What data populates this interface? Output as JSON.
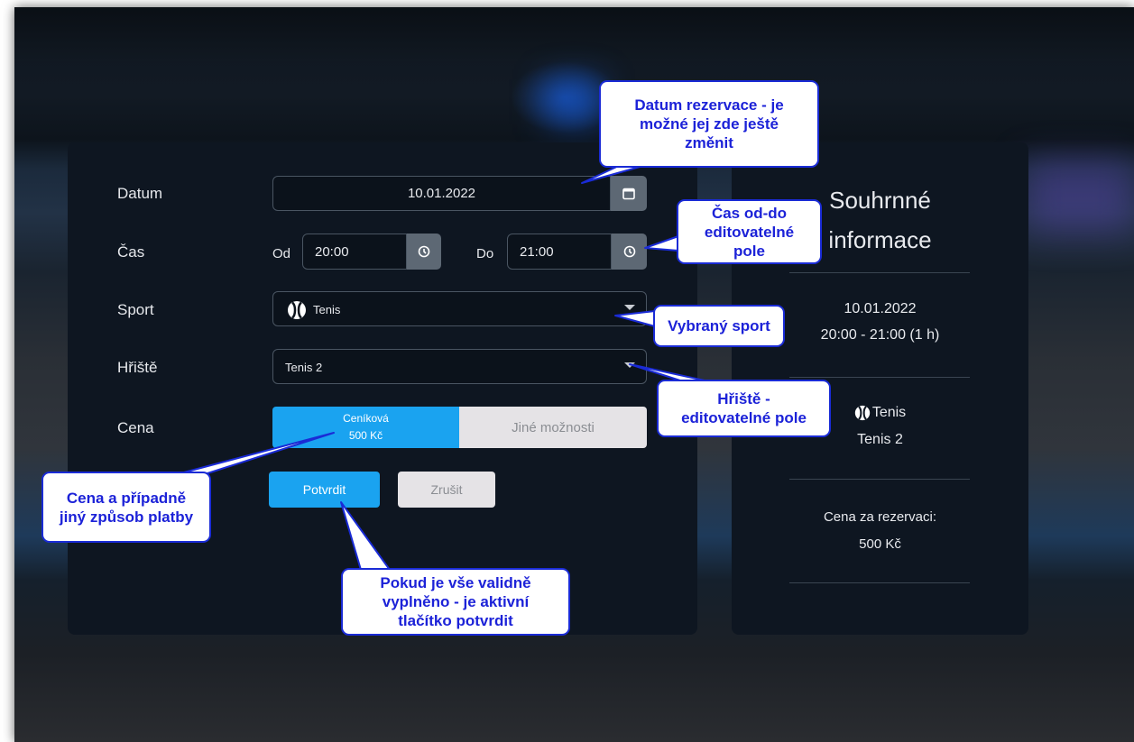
{
  "form": {
    "date_label": "Datum",
    "date_value": "10.01.2022",
    "time_label": "Čas",
    "from_label": "Od",
    "from_value": "20:00",
    "to_label": "Do",
    "to_value": "21:00",
    "sport_label": "Sport",
    "sport_value": "Tenis",
    "court_label": "Hřiště",
    "court_value": "Tenis 2",
    "price_label": "Cena",
    "price_option_a_line1": "Ceníková",
    "price_option_a_line2": "500 Kč",
    "price_option_b": "Jiné možnosti",
    "confirm_label": "Potvrdit",
    "cancel_label": "Zrušit"
  },
  "summary": {
    "title_line1": "Souhrnné",
    "title_line2": "informace",
    "date": "10.01.2022",
    "time_range": "20:00 - 21:00 (1 h)",
    "sport": "Tenis",
    "court": "Tenis 2",
    "price_label": "Cena za rezervaci:",
    "price_value": "500 Kč"
  },
  "callouts": {
    "date_line1": "Datum rezervace - je",
    "date_line2": "možné jej zde ještě",
    "date_line3": "změnit",
    "time_line1": "Čas od-do",
    "time_line2": "editovatelné",
    "time_line3": "pole",
    "sport": "Vybraný sport",
    "court_line1": "Hřiště -",
    "court_line2": "editovatelné pole",
    "price_line1": "Cena a případně",
    "price_line2": "jiný způsob platby",
    "confirm_line1": "Pokud je vše validně",
    "confirm_line2": "vyplněno - je aktivní",
    "confirm_line3": "tlačítko potvrdit"
  },
  "colors": {
    "accent": "#1aa3f0",
    "panel": "#0e1621",
    "callout_text": "#1c22d8",
    "callout_border": "#1a2bd6"
  },
  "icons": [
    "calendar-icon",
    "clock-icon",
    "tennis-ball-icon",
    "caret-down-icon"
  ]
}
